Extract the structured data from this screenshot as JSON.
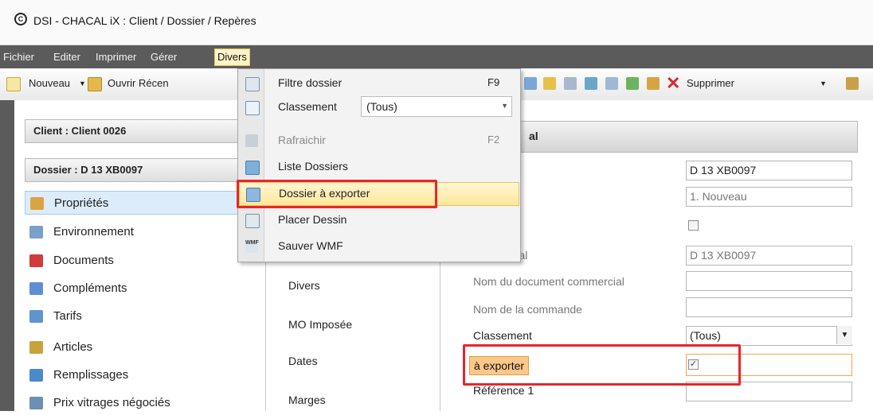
{
  "window": {
    "title": "DSI - CHACAL iX : Client / Dossier / Repères",
    "app_icon_glyph": "C"
  },
  "menubar": {
    "items": [
      "Fichier",
      "Editer",
      "Imprimer",
      "Gérer",
      "Divers"
    ],
    "active": "Divers"
  },
  "toolbar": {
    "new_label": "Nouveau",
    "open_recent_label": "Ouvrir Récen",
    "delete_label": "Supprimer"
  },
  "left": {
    "client_header": "Client : Client 0026",
    "dossier_header": "Dossier : D 13 XB0097",
    "items": [
      {
        "label": "Propriétés",
        "icon": "properties-icon",
        "color": "#d9a441"
      },
      {
        "label": "Environnement",
        "icon": "environment-icon",
        "color": "#7aa0c8"
      },
      {
        "label": "Documents",
        "icon": "pdf-icon",
        "color": "#d23b3b"
      },
      {
        "label": "Compléments",
        "icon": "complements-icon",
        "color": "#5c8fd6"
      },
      {
        "label": "Tarifs",
        "icon": "tarifs-icon",
        "color": "#5f94cf"
      },
      {
        "label": "Articles",
        "icon": "articles-icon",
        "color": "#c9a23e"
      },
      {
        "label": "Remplissages",
        "icon": "remplissages-icon",
        "color": "#4a8ac9"
      },
      {
        "label": "Prix vitrages négociés",
        "icon": "vitrages-icon",
        "color": "#6c8fb3"
      }
    ]
  },
  "middle": {
    "items": [
      "Divers",
      "MO Imposée",
      "Dates",
      "Marges"
    ]
  },
  "general": {
    "header_fragment": "al",
    "fields": [
      {
        "label": "",
        "value": "D 13 XB0097"
      },
      {
        "label": "",
        "value": "1. Nouveau"
      },
      {
        "label": "riginal",
        "value": "D 13 XB0097"
      },
      {
        "label": "Nom du document commercial",
        "value": ""
      },
      {
        "label": "Nom de la commande",
        "value": ""
      },
      {
        "label": "Classement",
        "value": "(Tous)"
      },
      {
        "label": "à exporter",
        "value": "✓"
      },
      {
        "label": "Référence 1",
        "value": ""
      }
    ]
  },
  "dropdown": {
    "items": [
      {
        "label": "Filtre dossier",
        "shortcut": "F9",
        "icon": "filter-icon"
      },
      {
        "label": "Classement",
        "shortcut": "",
        "icon": "list-icon",
        "combo_value": "(Tous)"
      },
      {
        "label": "Rafraichir",
        "shortcut": "F2",
        "icon": "refresh-icon"
      },
      {
        "label": "Liste Dossiers",
        "shortcut": "",
        "icon": "folder-list-icon"
      },
      {
        "label": "Dossier à exporter",
        "shortcut": "",
        "icon": "export-icon"
      },
      {
        "label": "Placer Dessin",
        "shortcut": "",
        "icon": "place-drawing-icon"
      },
      {
        "label": "Sauver WMF",
        "shortcut": "",
        "icon": "wmf-icon"
      }
    ],
    "wmf_icon_text": "WMF"
  },
  "colors": {
    "menubar": "#5b5b5b",
    "highlight": "#ffe79a",
    "annotation": "#e8262b",
    "selected": "#dcecfb"
  }
}
